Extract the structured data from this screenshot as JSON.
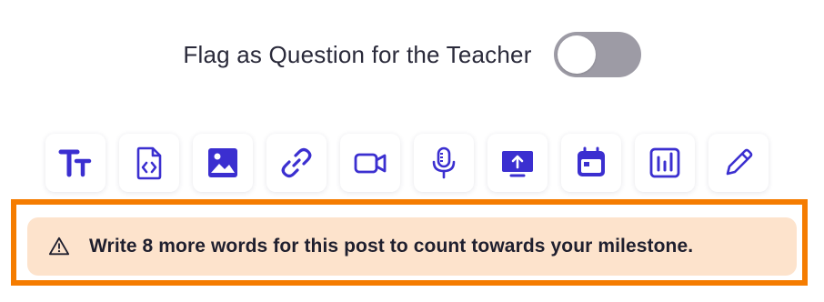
{
  "flag": {
    "label": "Flag as Question for the Teacher",
    "enabled": false
  },
  "toolbar": {
    "icon_color": "#3b2fd0",
    "items": [
      {
        "name": "text-format-icon"
      },
      {
        "name": "code-file-icon"
      },
      {
        "name": "image-icon"
      },
      {
        "name": "link-icon"
      },
      {
        "name": "video-icon"
      },
      {
        "name": "microphone-icon"
      },
      {
        "name": "screen-share-icon"
      },
      {
        "name": "calendar-icon"
      },
      {
        "name": "poll-chart-icon"
      },
      {
        "name": "pencil-icon"
      }
    ]
  },
  "notice": {
    "text": "Write 8 more words for this post to count towards your milestone.",
    "background": "#fde3cc",
    "highlight_border": "#f57c00"
  }
}
